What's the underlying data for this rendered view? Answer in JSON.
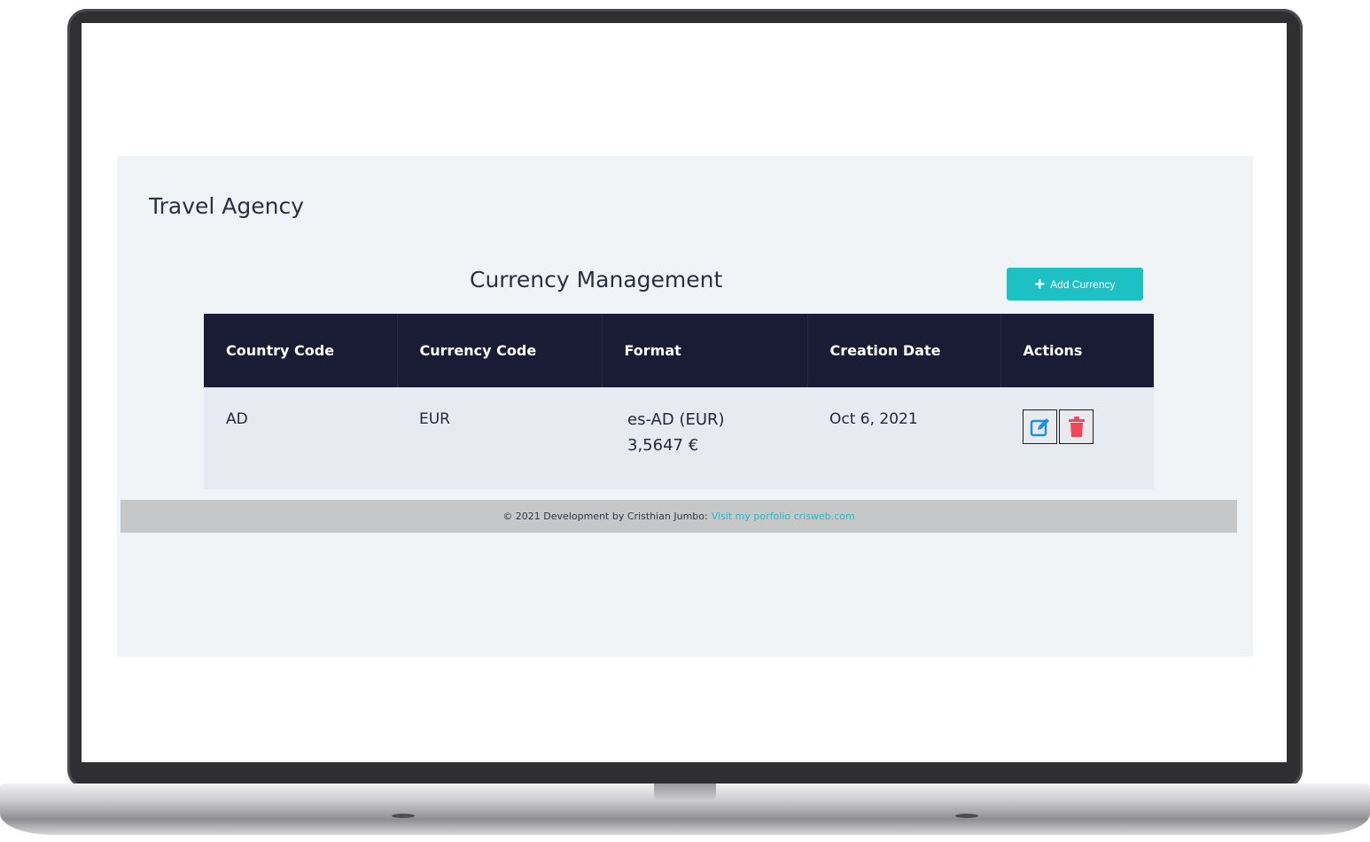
{
  "app": {
    "brand": "Travel Agency",
    "page_title": "Currency Management",
    "add_button_label": "Add Currency"
  },
  "table": {
    "headers": [
      "Country Code",
      "Currency Code",
      "Format",
      "Creation Date",
      "Actions"
    ],
    "rows": [
      {
        "country_code": "AD",
        "currency_code": "EUR",
        "format_line1": "es-AD (EUR)",
        "format_line2": "3,5647 €",
        "creation_date": "Oct 6, 2021"
      }
    ]
  },
  "footer": {
    "text": "© 2021 Development by Cristhian Jumbo:",
    "link_text": "Visit my porfolio crisweb.com"
  },
  "colors": {
    "accent": "#1ec1c3",
    "table_header": "#191c34",
    "delete_icon": "#f2475a",
    "edit_icon": "#1f8fe0"
  }
}
